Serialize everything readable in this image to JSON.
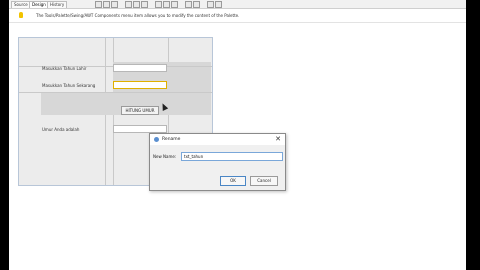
{
  "tabs": [
    {
      "label": "Source"
    },
    {
      "label": "Design"
    },
    {
      "label": "History"
    }
  ],
  "hint": {
    "text": "The Tools/Palette/Swing/AWT Components menu item allows you to modify the content of the Palette."
  },
  "form": {
    "label_birth_year": "Masukkan Tahun Lahir",
    "label_current_year": "Masukkan Tahun Sekarang",
    "button_label": "HITUNG UMUR",
    "label_age": "Umur Anda adalah"
  },
  "dialog": {
    "title": "Rename",
    "name_label": "New Name:",
    "name_value": "txt_tahun",
    "ok_label": "OK",
    "cancel_label": "Cancel",
    "close_symbol": "✕"
  },
  "colors": {
    "accent": "#4a86c5",
    "selection": "#e0b000"
  }
}
